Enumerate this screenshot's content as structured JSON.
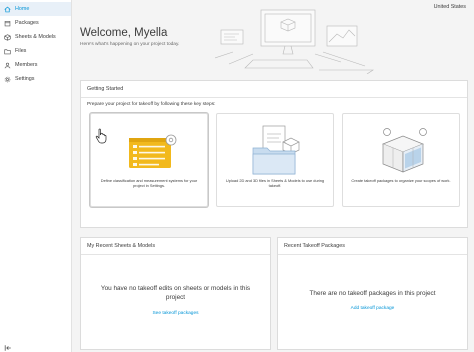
{
  "sidebar": {
    "items": [
      {
        "label": "Home",
        "icon": "home-icon",
        "active": true
      },
      {
        "label": "Packages",
        "icon": "packages-icon"
      },
      {
        "label": "Sheets & Models",
        "icon": "sheets-models-icon"
      },
      {
        "label": "Files",
        "icon": "folder-icon"
      },
      {
        "label": "Members",
        "icon": "members-icon"
      },
      {
        "label": "Settings",
        "icon": "gear-icon"
      }
    ],
    "collapse_icon": "collapse-sidebar-icon"
  },
  "header": {
    "region": "United States",
    "title": "Welcome, Myella",
    "subtitle": "Here's what's happening on your project today."
  },
  "getting_started": {
    "title": "Getting Started",
    "intro": "Prepare your project for takeoff by following these key steps:",
    "steps": [
      {
        "text": "Define classification and measurement systems for your project in Settings."
      },
      {
        "text": "Upload 2D and 3D files in Sheets & Models to use during takeoff."
      },
      {
        "text": "Create takeoff packages to organize your scopes of work."
      }
    ]
  },
  "recent_sheets": {
    "title": "My Recent Sheets & Models",
    "empty_message": "You have no takeoff edits on sheets or models in this project",
    "link": "See takeoff packages"
  },
  "recent_packages": {
    "title": "Recent Takeoff Packages",
    "empty_message": "There are no takeoff packages in this project",
    "link": "Add takeoff package"
  },
  "colors": {
    "accent": "#0696d7",
    "sidebar_active_bg": "#e8f0f8",
    "page_bg": "#f4f4f4",
    "illustration_yellow": "#f2b91d"
  }
}
